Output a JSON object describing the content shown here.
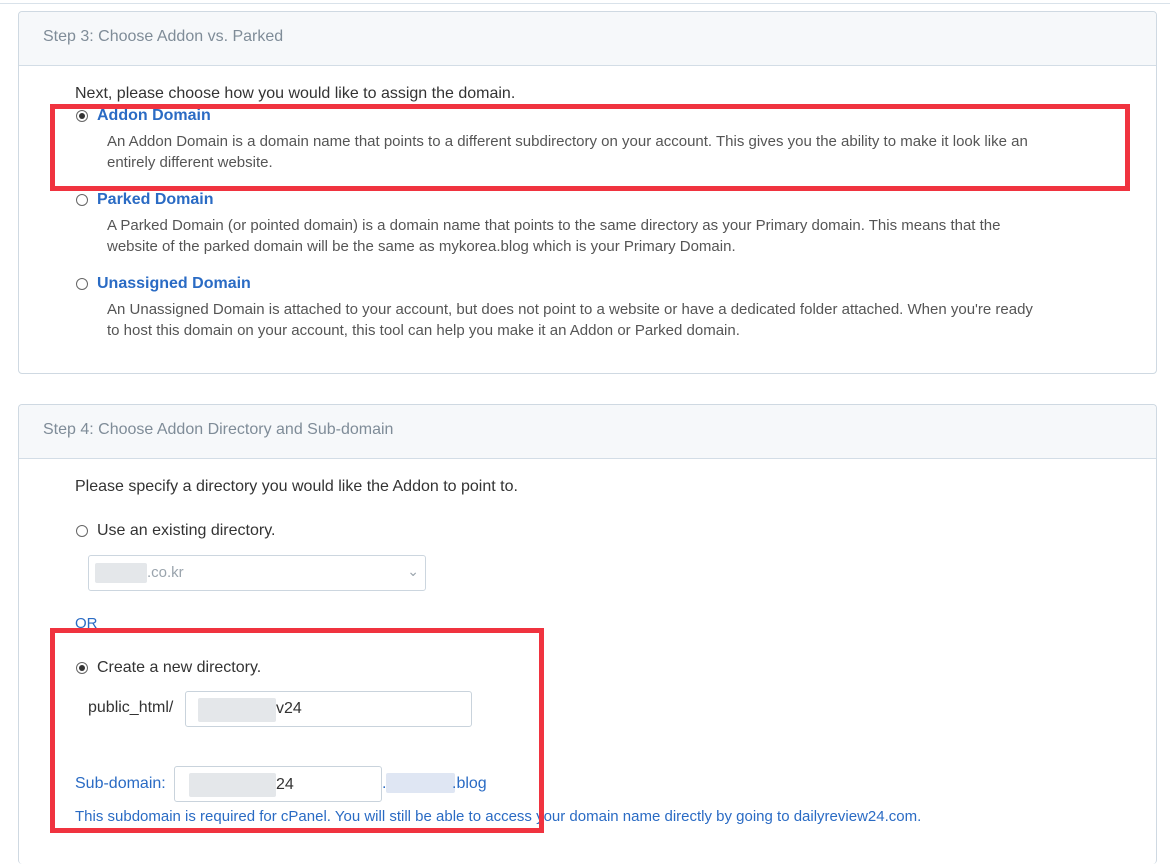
{
  "step3": {
    "header": "Step 3: Choose Addon vs. Parked",
    "intro": "Next, please choose how you would like to assign the domain.",
    "options": [
      {
        "label": "Addon Domain",
        "checked": true,
        "desc_line1": "An Addon Domain is a domain name that points to a different subdirectory on your account. This gives you the ability to make it look like an",
        "desc_line2": "entirely different website."
      },
      {
        "label": "Parked Domain",
        "checked": false,
        "desc_line1": "A Parked Domain (or pointed domain) is a domain name that points to the same directory as your Primary domain. This means that the",
        "desc_line2": "website of the parked domain will be the same as mykorea.blog which is your Primary Domain."
      },
      {
        "label": "Unassigned Domain",
        "checked": false,
        "desc_line1": "An Unassigned Domain is attached to your account, but does not point to a website or have a dedicated folder attached. When you're ready",
        "desc_line2": "to host this domain on your account, this tool can help you make it an Addon or Parked domain."
      }
    ]
  },
  "step4": {
    "header": "Step 4: Choose Addon Directory and Sub-domain",
    "intro": "Please specify a directory you would like the Addon to point to.",
    "existing_label": "Use an existing directory.",
    "existing_select_value": ".co.kr",
    "or_text": "OR",
    "new_label": "Create a new directory.",
    "public_html_label": "public_html/",
    "directory_value": "v24",
    "subdomain_label": "Sub-domain:",
    "subdomain_value": "24",
    "domain_suffix": ".blog",
    "note": "This subdomain is required for cPanel. You will still be able to access your domain name directly by going to dailyreview24.com."
  },
  "colors": {
    "link": "#2a6bc4",
    "highlight": "#f0333f",
    "header_text": "#7f8c98"
  }
}
